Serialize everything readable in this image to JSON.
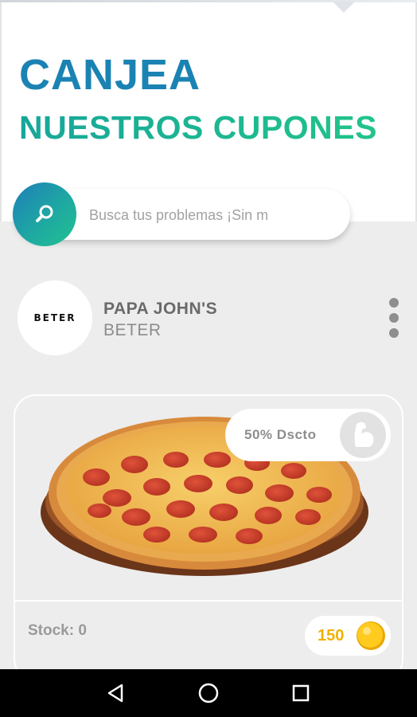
{
  "header": {
    "title_line1": "CANJEA",
    "title_line2": "NUESTROS CUPONES"
  },
  "search": {
    "placeholder": "Busca tus problemas ¡Sin m",
    "icon": "search-icon"
  },
  "brand": {
    "logo_text": "BETER",
    "name": "PAPA JOHN'S",
    "subtitle": "BETER",
    "menu_icon": "more-vertical-icon"
  },
  "coupon": {
    "image": "pizza-image",
    "discount_label": "50% Dscto",
    "discount_icon": "muscle-arm-icon",
    "stock_label": "Stock: 0",
    "price": "150",
    "price_icon": "coin-icon"
  },
  "colors": {
    "title_blue": "#1b83b3",
    "title_green": "#17a69a",
    "coin_gold": "#f0b100"
  },
  "navigation": {
    "items": [
      "back-icon",
      "home-icon",
      "recents-icon"
    ]
  }
}
